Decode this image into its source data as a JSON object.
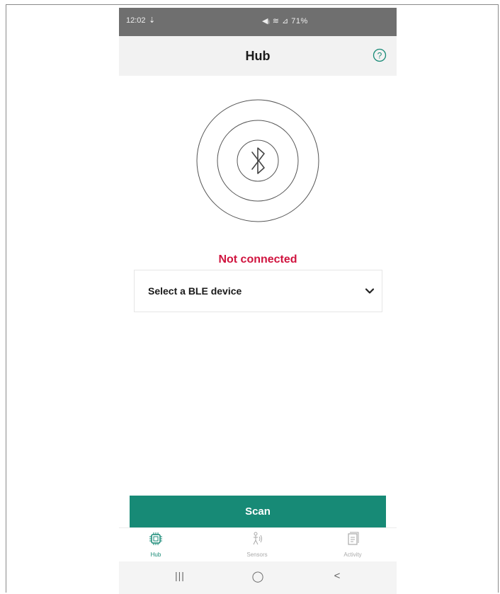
{
  "status_bar": {
    "time": "12:02",
    "time_icon": "download-icon",
    "right_text": "◀ᵢ ≋ ⊿ 71%"
  },
  "app_bar": {
    "title": "Hub",
    "help_icon": "help-icon"
  },
  "connection": {
    "status": "Not connected",
    "status_color": "#d0143f"
  },
  "device_select": {
    "selected": "Select a BLE device"
  },
  "scan": {
    "label": "Scan",
    "color": "#178a76"
  },
  "bottom_nav": {
    "items": [
      {
        "label": "Hub",
        "icon": "chip-icon",
        "active": true
      },
      {
        "label": "Sensors",
        "icon": "sensor-icon",
        "active": false
      },
      {
        "label": "Activity",
        "icon": "activity-icon",
        "active": false
      }
    ]
  },
  "system_nav": {
    "recents": "|||",
    "home": "◯",
    "back": "<"
  }
}
